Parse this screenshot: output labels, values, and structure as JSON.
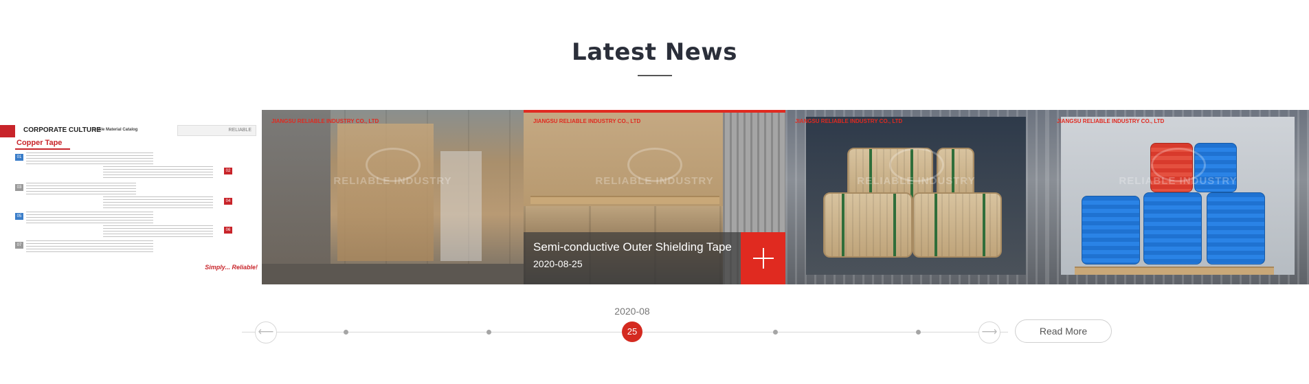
{
  "section": {
    "title": "Latest News"
  },
  "slides": [
    {
      "type": "catalog",
      "header_title": "CORPORATE CULTURE",
      "header_subtitle": "Cable Material Catalog",
      "logo_text": "RELIABLE",
      "product_name": "Copper Tape",
      "step_numbers": [
        "01",
        "02",
        "03",
        "04",
        "05",
        "06",
        "07"
      ],
      "slogan": "Simply... Reliable!"
    },
    {
      "type": "photo",
      "stamp": "JIANGSU RELIABLE INDUSTRY CO., LTD",
      "watermark": "RELIABLE INDUSTRY"
    },
    {
      "type": "photo",
      "active": true,
      "stamp": "JIANGSU RELIABLE INDUSTRY CO., LTD",
      "watermark": "RELIABLE INDUSTRY",
      "caption_title": "Semi-conductive Outer Shielding Tape",
      "caption_date": "2020-08-25"
    },
    {
      "type": "photo",
      "stamp": "JIANGSU RELIABLE INDUSTRY CO., LTD",
      "watermark": "RELIABLE INDUSTRY"
    },
    {
      "type": "photo",
      "stamp": "JIANGSU RELIABLE INDUSTRY CO., LTD",
      "watermark": "RELIABLE INDUSTRY"
    }
  ],
  "timeline": {
    "month": "2020-08",
    "active_day": "25",
    "prev_icon": "arrow-left-icon",
    "next_icon": "arrow-right-icon"
  },
  "read_more": "Read More",
  "colors": {
    "accent": "#e02a20",
    "title": "#2b2f3a"
  }
}
